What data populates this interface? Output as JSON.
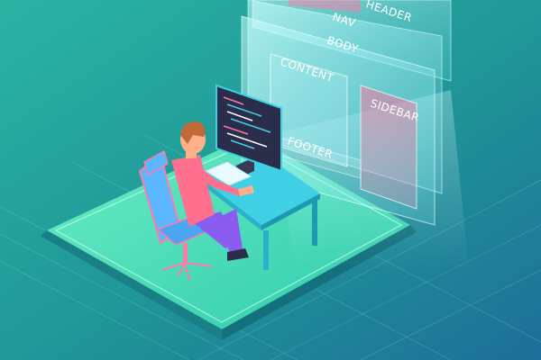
{
  "illustration": {
    "layers": {
      "header": "HEADER",
      "nav": "NAV",
      "body": "BODY",
      "content": "CONTENT",
      "sidebar": "SIDEBAR",
      "footer": "FOOTER"
    }
  }
}
